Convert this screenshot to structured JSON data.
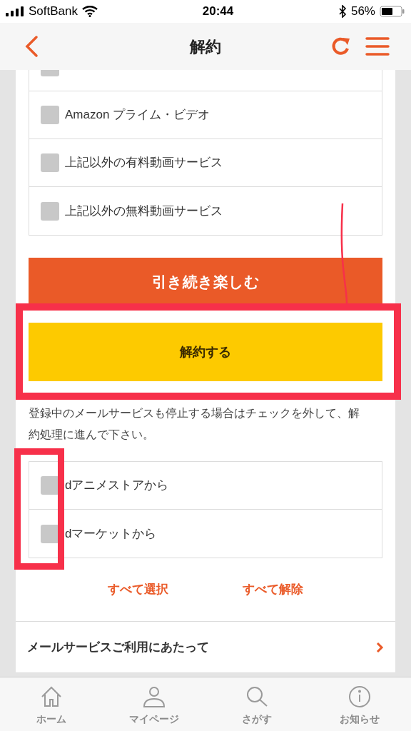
{
  "status_bar": {
    "carrier": "SoftBank",
    "time": "20:44",
    "battery": "56%"
  },
  "header": {
    "title": "解約"
  },
  "services": [
    {
      "checked": false
    },
    {
      "label": "Amazon プライム・ビデオ",
      "checked": false
    },
    {
      "label": "上記以外の有料動画サービス",
      "checked": false
    },
    {
      "label": "上記以外の無料動画サービス",
      "checked": false
    }
  ],
  "continue_button": "引き続き楽しむ",
  "cancel_button": "解約する",
  "notice": "登録中のメールサービスも停止する場合はチェックを外して、解約処理に進んで下さい。",
  "mail_services": [
    {
      "label": "dアニメストアから",
      "checked": false
    },
    {
      "label": "dマーケットから",
      "checked": false
    }
  ],
  "links": [
    "すべて選択",
    "すべて解除"
  ],
  "menu_item": "メールサービスご利用にあたって",
  "tab_bar": [
    {
      "label": "ホーム",
      "kind": "home"
    },
    {
      "label": "マイページ",
      "kind": "user"
    },
    {
      "label": "さがす",
      "kind": "search"
    },
    {
      "label": "お知らせ",
      "kind": "info"
    }
  ]
}
